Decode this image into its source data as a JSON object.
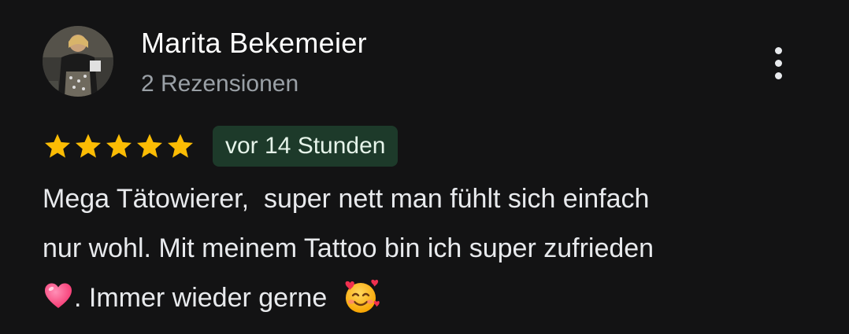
{
  "reviewer": {
    "name": "Marita Bekemeier",
    "review_count": "2 Rezensionen",
    "avatar_icon": "profile-photo"
  },
  "menu": {
    "icon": "more-vert-icon"
  },
  "review": {
    "rating": 5,
    "max_rating": 5,
    "star_color": "#fbbc04",
    "time": "vor 14 Stunden",
    "text_line1": "Mega Tätowierer,  super nett man fühlt sich einfach",
    "text_line2": "nur wohl. Mit meinem Tattoo bin ich super zufrieden",
    "text_line3_after_heart": ". Immer wieder gerne  ",
    "emoji_1": "pink-heart-emoji",
    "emoji_2": "smiling-face-with-hearts-emoji"
  },
  "colors": {
    "background": "#131314",
    "badge_background": "#1d3a2a",
    "secondary_text": "#9aa0a6"
  }
}
